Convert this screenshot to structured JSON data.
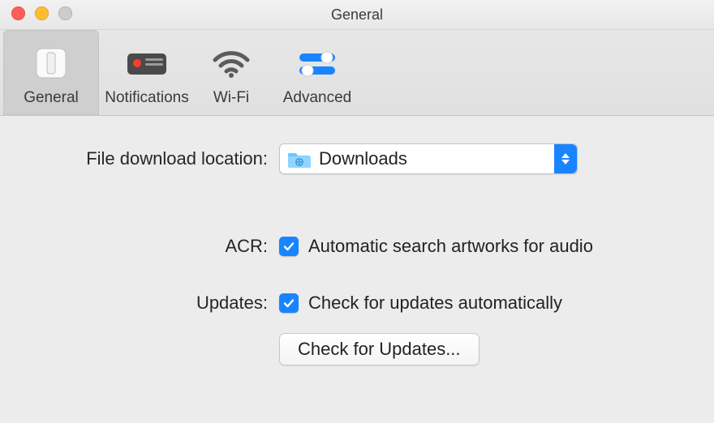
{
  "window": {
    "title": "General"
  },
  "toolbar": {
    "tabs": [
      {
        "label": "General",
        "active": true
      },
      {
        "label": "Notifications",
        "active": false
      },
      {
        "label": "Wi-Fi",
        "active": false
      },
      {
        "label": "Advanced",
        "active": false
      }
    ]
  },
  "settings": {
    "download_location": {
      "label": "File download location:",
      "value": "Downloads"
    },
    "acr": {
      "label": "ACR:",
      "checkbox_label": "Automatic search artworks for audio",
      "checked": true
    },
    "updates": {
      "label": "Updates:",
      "checkbox_label": "Check for updates automatically",
      "checked": true,
      "button_label": "Check for Updates..."
    }
  }
}
